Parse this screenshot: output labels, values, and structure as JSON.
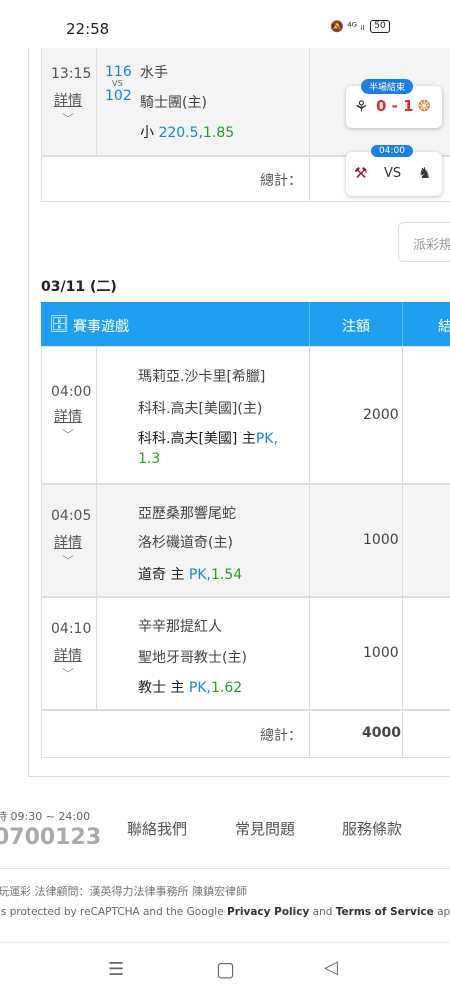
{
  "status": {
    "time": "22:58",
    "icons": "🔕 ⁴ᴳ ᵢₗ",
    "battery": "50"
  },
  "top_match": {
    "time": "13:15",
    "detail": "詳情",
    "num_a": "116",
    "vs": "VS",
    "num_b": "102",
    "team_a": "水手",
    "team_b": "騎士團(主)",
    "bet_prefix": "小",
    "bet_line": "220.5,",
    "bet_odds": "1.85",
    "total_label": "總計："
  },
  "score_cards": [
    {
      "badge": "半場結束",
      "score": "0 - 1"
    },
    {
      "badge": "04:00",
      "vs": "VS"
    }
  ],
  "side_button": "派彩規",
  "date_label": "03/11 (二)",
  "table_header": {
    "game": "賽事遊戲",
    "amount": "注額",
    "result": "結"
  },
  "rows": [
    {
      "time": "04:00",
      "detail": "詳情",
      "team_a": "瑪莉亞.沙卡里[希臘]",
      "team_b": "科科.高夫[美國](主)",
      "bet_team": "科科.高夫[美國] 主",
      "bet_type": "PK,",
      "bet_odds": "1.3",
      "amount": "2000"
    },
    {
      "time": "04:05",
      "detail": "詳情",
      "team_a": "亞歷桑那響尾蛇",
      "team_b": "洛杉磯道奇(主)",
      "bet_team": "道奇 主",
      "bet_type": "PK,",
      "bet_odds": "1.54",
      "amount": "1000"
    },
    {
      "time": "04:10",
      "detail": "詳情",
      "team_a": "辛辛那提紅人",
      "team_b": "聖地牙哥教士(主)",
      "bet_team": "教士 主",
      "bet_type": "PK,",
      "bet_odds": "1.62",
      "amount": "1000"
    }
  ],
  "total": {
    "label": "總計：",
    "value": "4000"
  },
  "footer": {
    "hours": "時 09:30 ~ 24:00",
    "phone": "0700123",
    "contact": "聯絡我們",
    "faq": "常見問題",
    "terms": "服務條款",
    "legal": "玩運彩 法律顧問：漢英得力法律事務所 陳鎮宏律師",
    "recaptcha_pre": "is protected by reCAPTCHA and the Google ",
    "privacy": "Privacy Policy",
    "and": " and ",
    "tos": "Terms of Service",
    "recaptcha_post": " app"
  },
  "sysnav": {
    "menu": "☰",
    "home": "▢",
    "back": "◁"
  }
}
